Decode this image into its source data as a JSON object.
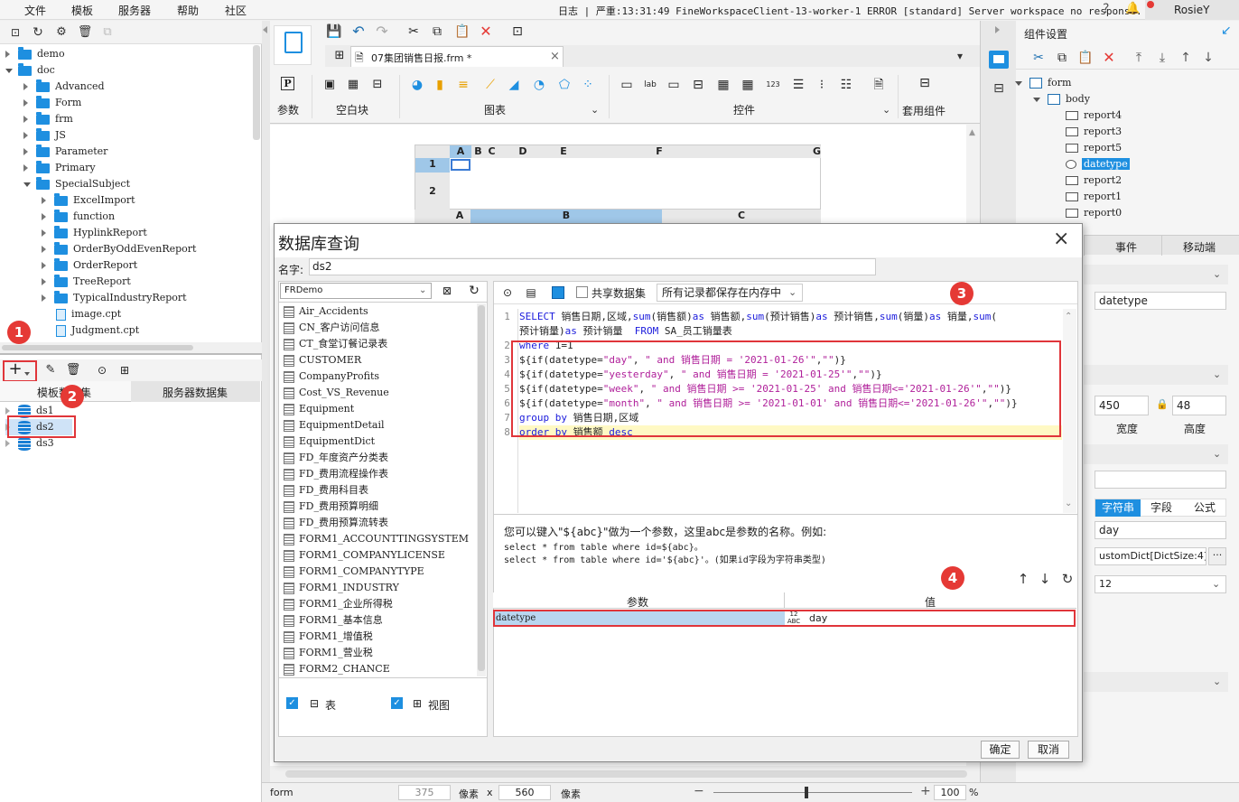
{
  "menu": {
    "items": [
      "文件",
      "模板",
      "服务器",
      "帮助",
      "社区"
    ],
    "log": "日志 | 严重:13:31:49 FineWorkspaceClient-13-worker-1 ERROR [standard] Server workspace no response.",
    "user": "RosieY"
  },
  "file_tree": [
    {
      "label": "demo",
      "level": 0,
      "expanded": false,
      "type": "folder"
    },
    {
      "label": "doc",
      "level": 0,
      "expanded": true,
      "type": "folder"
    },
    {
      "label": "Advanced",
      "level": 1,
      "expanded": false,
      "type": "folder"
    },
    {
      "label": "Form",
      "level": 1,
      "expanded": false,
      "type": "folder"
    },
    {
      "label": "frm",
      "level": 1,
      "expanded": false,
      "type": "folder"
    },
    {
      "label": "JS",
      "level": 1,
      "expanded": false,
      "type": "folder"
    },
    {
      "label": "Parameter",
      "level": 1,
      "expanded": false,
      "type": "folder"
    },
    {
      "label": "Primary",
      "level": 1,
      "expanded": false,
      "type": "folder"
    },
    {
      "label": "SpecialSubject",
      "level": 1,
      "expanded": true,
      "type": "folder"
    },
    {
      "label": "ExcelImport",
      "level": 2,
      "expanded": false,
      "type": "folder"
    },
    {
      "label": "function",
      "level": 2,
      "expanded": false,
      "type": "folder"
    },
    {
      "label": "HyplinkReport",
      "level": 2,
      "expanded": false,
      "type": "folder"
    },
    {
      "label": "OrderByOddEvenReport",
      "level": 2,
      "expanded": false,
      "type": "folder"
    },
    {
      "label": "OrderReport",
      "level": 2,
      "expanded": false,
      "type": "folder"
    },
    {
      "label": "TreeReport",
      "level": 2,
      "expanded": false,
      "type": "folder"
    },
    {
      "label": "TypicalIndustryReport",
      "level": 2,
      "expanded": false,
      "type": "folder"
    },
    {
      "label": "image.cpt",
      "level": 2,
      "expanded": false,
      "type": "file"
    },
    {
      "label": "Judgment.cpt",
      "level": 2,
      "expanded": false,
      "type": "file"
    }
  ],
  "dataset_panel": {
    "tabs": [
      "模板数据集",
      "服务器数据集"
    ],
    "datasets": [
      "ds1",
      "ds2",
      "ds3"
    ]
  },
  "editor": {
    "tab_title": "07集团销售日报.frm *",
    "sections": [
      "参数",
      "空白块",
      "图表",
      "控件",
      "套用组件"
    ],
    "sheet_cols": [
      "A",
      "B",
      "C",
      "D",
      "E",
      "F",
      "G"
    ],
    "sheet_rows": [
      "1",
      "2"
    ],
    "sheet2_cols": [
      "A",
      "B",
      "C"
    ]
  },
  "dialog": {
    "title": "数据库查询",
    "name_label": "名字:",
    "name_value": "ds2",
    "connection": "FRDemo",
    "share_label": "共享数据集",
    "memory_option": "所有记录都保存在内存中",
    "tables": [
      "Air_Accidents",
      "CN_客户访问信息",
      "CT_食堂订餐记录表",
      "CUSTOMER",
      "CompanyProfits",
      "Cost_VS_Revenue",
      "Equipment",
      "EquipmentDetail",
      "EquipmentDict",
      "FD_年度资产分类表",
      "FD_费用流程操作表",
      "FD_费用科目表",
      "FD_费用预算明细",
      "FD_费用预算流转表",
      "FORM1_ACCOUNTTINGSYSTEM",
      "FORM1_COMPANYLICENSE",
      "FORM1_COMPANYTYPE",
      "FORM1_INDUSTRY",
      "FORM1_企业所得税",
      "FORM1_基本信息",
      "FORM1_增值税",
      "FORM1_营业税",
      "FORM2_CHANCE"
    ],
    "filter_table": "表",
    "filter_view": "视图",
    "sql_lines": [
      {
        "n": "1",
        "parts": [
          [
            "kw",
            "SELECT"
          ],
          [
            "t",
            " 销售日期,区域,"
          ],
          [
            "kw",
            "sum"
          ],
          [
            "t",
            "(销售额)"
          ],
          [
            "kw",
            "as"
          ],
          [
            "t",
            " 销售额,"
          ],
          [
            "kw",
            "sum"
          ],
          [
            "t",
            "(预计销售)"
          ],
          [
            "kw",
            "as"
          ],
          [
            "t",
            " 预计销售,"
          ],
          [
            "kw",
            "sum"
          ],
          [
            "t",
            "(销量)"
          ],
          [
            "kw",
            "as"
          ],
          [
            "t",
            " 销量,"
          ],
          [
            "kw",
            "sum"
          ],
          [
            "t",
            "("
          ]
        ]
      },
      {
        "n": "",
        "parts": [
          [
            "t",
            "预计销量)"
          ],
          [
            "kw",
            "as"
          ],
          [
            "t",
            " 预计销量  "
          ],
          [
            "kw",
            "FROM"
          ],
          [
            "t",
            " SA_员工销量表"
          ]
        ]
      },
      {
        "n": "2",
        "parts": [
          [
            "kw",
            "where"
          ],
          [
            "t",
            " 1=1"
          ]
        ]
      },
      {
        "n": "3",
        "parts": [
          [
            "t",
            "${if(datetype="
          ],
          [
            "str",
            "\"day\""
          ],
          [
            "t",
            ", "
          ],
          [
            "str",
            "\" and 销售日期 = '2021-01-26'\""
          ],
          [
            "t",
            ","
          ],
          [
            "str",
            "\"\""
          ],
          [
            "t",
            ")}"
          ]
        ]
      },
      {
        "n": "4",
        "parts": [
          [
            "t",
            "${if(datetype="
          ],
          [
            "str",
            "\"yesterday\""
          ],
          [
            "t",
            ", "
          ],
          [
            "str",
            "\" and 销售日期 = '2021-01-25'\""
          ],
          [
            "t",
            ","
          ],
          [
            "str",
            "\"\""
          ],
          [
            "t",
            ")}"
          ]
        ]
      },
      {
        "n": "5",
        "parts": [
          [
            "t",
            "${if(datetype="
          ],
          [
            "str",
            "\"week\""
          ],
          [
            "t",
            ", "
          ],
          [
            "str",
            "\" and 销售日期 >= '2021-01-25' and 销售日期<='2021-01-26'\""
          ],
          [
            "t",
            ","
          ],
          [
            "str",
            "\"\""
          ],
          [
            "t",
            ")}"
          ]
        ]
      },
      {
        "n": "6",
        "parts": [
          [
            "t",
            "${if(datetype="
          ],
          [
            "str",
            "\"month\""
          ],
          [
            "t",
            ", "
          ],
          [
            "str",
            "\" and 销售日期 >= '2021-01-01' and 销售日期<='2021-01-26'\""
          ],
          [
            "t",
            ","
          ],
          [
            "str",
            "\"\""
          ],
          [
            "t",
            ")}"
          ]
        ]
      },
      {
        "n": "7",
        "parts": [
          [
            "kw",
            "group by"
          ],
          [
            "t",
            " 销售日期,区域"
          ]
        ]
      },
      {
        "n": "8",
        "parts": [
          [
            "kw",
            "order by"
          ],
          [
            "t",
            " 销售额 "
          ],
          [
            "kw",
            "desc"
          ]
        ]
      }
    ],
    "hint": [
      "您可以键入\"${abc}\"做为一个参数，这里abc是参数的名称。例如:",
      "select * from table where id=${abc}。",
      "select * from table where id='${abc}'。(如果id字段为字符串类型)"
    ],
    "param_headers": [
      "参数",
      "值"
    ],
    "params": [
      {
        "name": "datetype",
        "value": "day"
      }
    ],
    "ok": "确定",
    "cancel": "取消"
  },
  "right_panel": {
    "title": "组件设置",
    "tree": [
      "form",
      "body",
      "report4",
      "report3",
      "report5",
      "datetype",
      "report2",
      "report1",
      "report0"
    ],
    "tabs": [
      "事件",
      "移动端"
    ],
    "widget_name": "datetype",
    "width": "450",
    "height": "48",
    "width_label": "宽度",
    "height_label": "高度",
    "value_tabs": [
      "字符串",
      "字段",
      "公式"
    ],
    "value": "day",
    "dict": "ustomDict[DictSize:4]",
    "font_size": "12"
  },
  "status": {
    "name": "form",
    "width": "375",
    "unit1": "像素",
    "x": "x",
    "height": "560",
    "unit2": "像素",
    "zoom": "100",
    "pct": "%"
  },
  "badges": [
    "1",
    "2",
    "3",
    "4"
  ]
}
